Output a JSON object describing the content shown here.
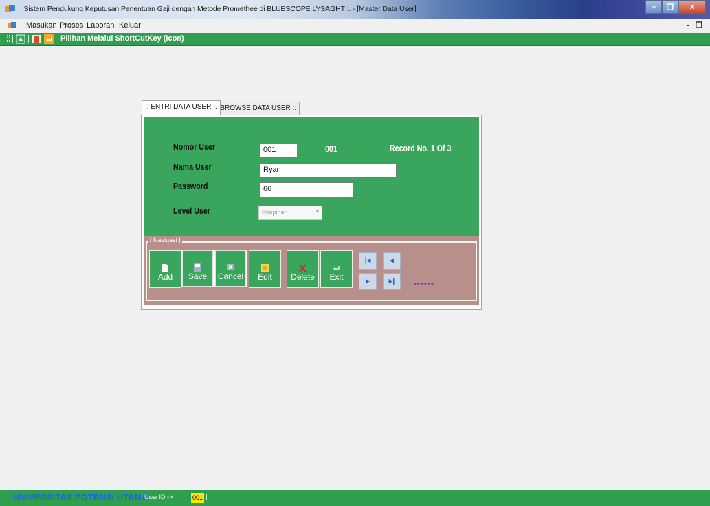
{
  "window": {
    "title": ".: Sistem Pendukung Keputusan Penentuan Gaji dengan Metode Promethee di BLUESCOPE LYSAGHT :. - [Master Data User]",
    "min_symbol": "–",
    "max_symbol": "❐",
    "close_symbol": "x"
  },
  "menu": {
    "items": [
      "Masukan",
      "Proses",
      "Laporan",
      "Keluar"
    ],
    "mdi_controls": "- ❐"
  },
  "toolbar": {
    "label": "Pilihan Melalui ShortCutKey (Icon)"
  },
  "tabs": [
    {
      "label": ".: ENTRI DATA USER :."
    },
    {
      "label": ".: BROWSE DATA USER :."
    }
  ],
  "form": {
    "nomor_user_label": "Nomor User",
    "nomor_user_value": "001",
    "nomor_user_display": "001",
    "record_info": "Record No. 1 Of 3",
    "nama_user_label": "Nama User",
    "nama_user_value": "Ryan",
    "password_label": "Password",
    "password_value": "66",
    "level_user_label": "Level User",
    "level_user_value": "Pimpinan"
  },
  "navigasi": {
    "legend": "[ Navigasi ]",
    "buttons": [
      "Add",
      "Save",
      "Cancel",
      "Edit",
      "Delete",
      "Exit"
    ],
    "first_icon": "first-record-icon",
    "prev_icon": "previous-record-icon",
    "next_icon": "next-record-icon",
    "last_icon": "last-record-icon",
    "dashes": "------"
  },
  "status": {
    "university": "UNIVERSITAS POTENSI UTAMA",
    "user_label": "User ID ->",
    "user_id": "001"
  },
  "colors": {
    "accent_green": "#3aa55d",
    "nav_panel": "#b98f8c",
    "status_blue": "#1e63e0"
  }
}
